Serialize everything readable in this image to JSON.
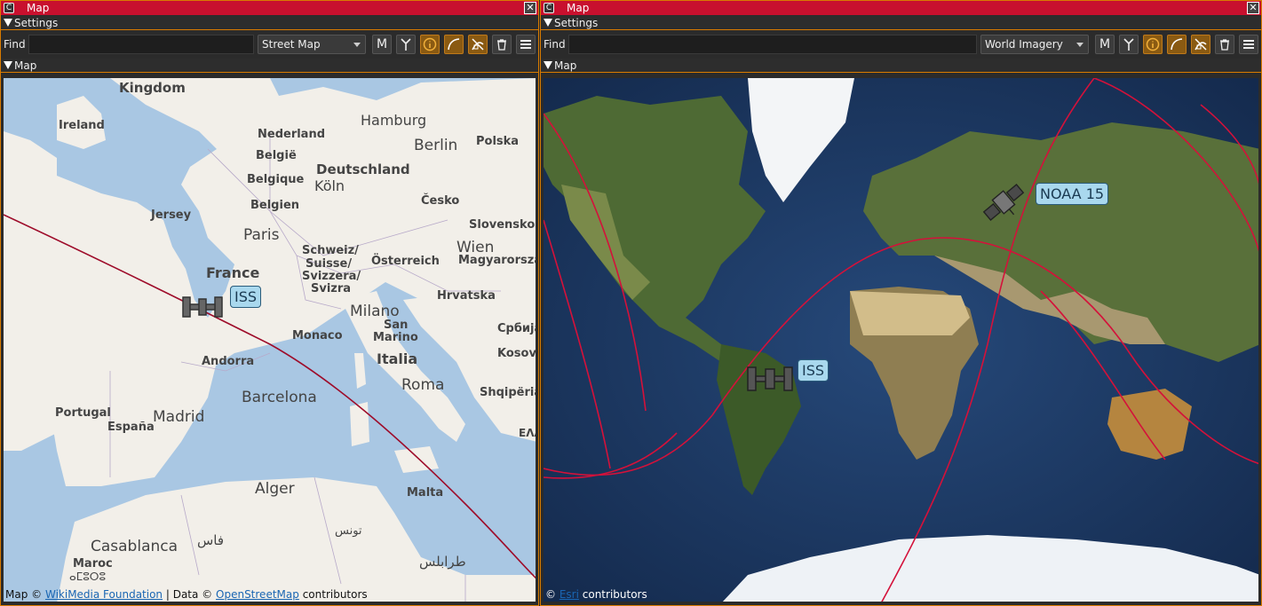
{
  "windows": [
    {
      "title": "Map",
      "settings_label": "Settings",
      "find_label": "Find",
      "find_value": "",
      "map_style": "Street Map",
      "map_section_label": "Map",
      "attribution": {
        "prefix": "Map ©",
        "link1": "WikiMedia Foundation",
        "middle": "| Data ©",
        "link2": "OpenStreetMap",
        "suffix": "contributors"
      },
      "labels": {
        "kingdom": "Kingdom",
        "ireland": "Ireland",
        "hamburg": "Hamburg",
        "nederland": "Nederland",
        "berlin": "Berlin",
        "polska": "Polska",
        "belgie": "België",
        "belgique": "Belgique",
        "belgien": "Belgien",
        "deutschland": "Deutschland",
        "koln": "Köln",
        "jersey": "Jersey",
        "cesko": "Česko",
        "slovensko": "Slovensko",
        "paris": "Paris",
        "schweiz": "Schweiz/",
        "suisse": "Suisse/",
        "svizzera": "Svizzera/",
        "svizra": "Svizra",
        "osterreich": "Österreich",
        "wien": "Wien",
        "magyar": "Magyarorszá",
        "france": "France",
        "hrvatska": "Hrvatska",
        "milano": "Milano",
        "monaco": "Monaco",
        "san": "San",
        "marino": "Marino",
        "srbija": "Србија",
        "andorra": "Andorra",
        "italia": "Italia",
        "kosovo": "Kosovo",
        "roma": "Roma",
        "barcelona": "Barcelona",
        "shqiperia": "Shqipëria",
        "portugal": "Portugal",
        "madrid": "Madrid",
        "espana": "España",
        "ellada": "ΕΛΛ",
        "alger": "Alger",
        "malta": "Malta",
        "tunis": "تونس",
        "casablanca": "Casablanca",
        "fas": "فاس",
        "maroc": "Maroc",
        "tarablus": "طرابلس",
        "amazigh": "ⴰⵎⵓⵔⵓ"
      },
      "satellites": [
        {
          "name": "ISS",
          "icon": "satellite-icon"
        }
      ]
    },
    {
      "title": "Map",
      "settings_label": "Settings",
      "find_label": "Find",
      "find_value": "",
      "map_style": "World Imagery",
      "map_section_label": "Map",
      "attribution": {
        "prefix": "©",
        "link1": "Esri",
        "suffix": "contributors"
      },
      "satellites": [
        {
          "name": "NOAA 15",
          "icon": "satellite-icon"
        },
        {
          "name": "ISS",
          "icon": "satellite-icon"
        }
      ]
    }
  ],
  "toolbar_buttons": [
    {
      "name": "m-button",
      "glyph": "M"
    },
    {
      "name": "antenna-button",
      "glyph": "Y"
    },
    {
      "name": "info-button",
      "glyph": "i"
    },
    {
      "name": "curve-button",
      "glyph": "⌒"
    },
    {
      "name": "satellite-tracks-button",
      "glyph": "✕"
    },
    {
      "name": "delete-button",
      "glyph": "🗑"
    },
    {
      "name": "menu-button",
      "glyph": "≡"
    }
  ],
  "colors": {
    "title_bar": "#c8102e",
    "border": "#d97b00",
    "track": "#c8102e",
    "sea_street": "#a9c7e3",
    "land_street": "#f2efe9",
    "ocean_imagery": "#1f3b63"
  }
}
